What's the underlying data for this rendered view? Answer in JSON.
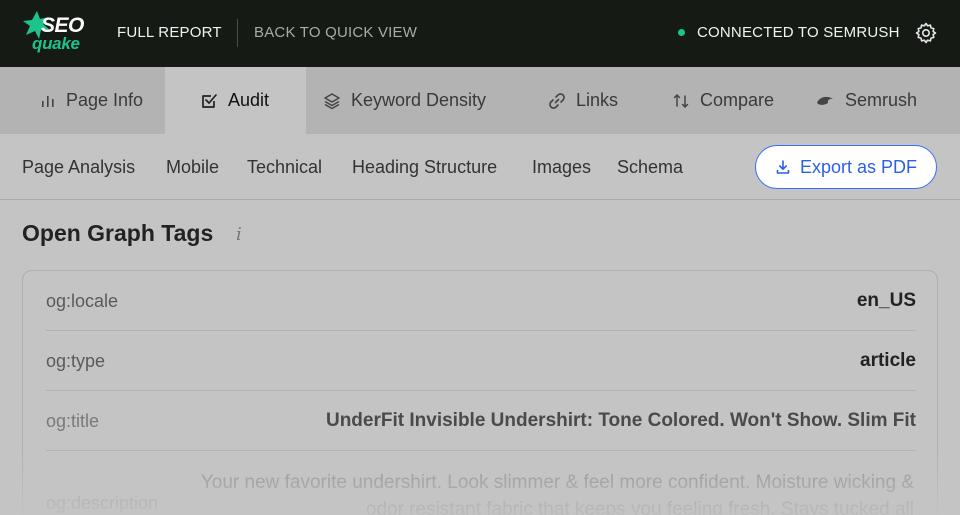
{
  "logo": {
    "top": "SEO",
    "bottom": "quake"
  },
  "topbar": {
    "full_report": "FULL REPORT",
    "back_quick": "BACK TO QUICK VIEW",
    "connected": "CONNECTED TO SEMRUSH",
    "accent_color": "#1cc48c"
  },
  "tabs": [
    {
      "label": "Page Info",
      "icon": "bar-chart-icon"
    },
    {
      "label": "Audit",
      "icon": "checkbox-icon",
      "active": true
    },
    {
      "label": "Keyword Density",
      "icon": "layers-icon"
    },
    {
      "label": "Links",
      "icon": "link-icon"
    },
    {
      "label": "Compare",
      "icon": "sort-arrows-icon"
    },
    {
      "label": "Semrush",
      "icon": "semrush-icon"
    }
  ],
  "subtabs": [
    "Page Analysis",
    "Mobile",
    "Technical",
    "Heading Structure",
    "Images",
    "Schema"
  ],
  "export": {
    "label": "Export as PDF",
    "color": "#2b5fe8"
  },
  "section": {
    "title": "Open Graph Tags",
    "info": "i"
  },
  "og_rows": [
    {
      "key": "og:locale",
      "value": "en_US"
    },
    {
      "key": "og:type",
      "value": "article"
    },
    {
      "key": "og:title",
      "value": "UnderFit Invisible Undershirt: Tone Colored. Won't Show. Slim Fit"
    },
    {
      "key": "og:description",
      "value": "Your new favorite undershirt. Look slimmer & feel more confident. Moisture wicking & odor resistant fabric that keeps you feeling fresh. Stays tucked all"
    }
  ]
}
